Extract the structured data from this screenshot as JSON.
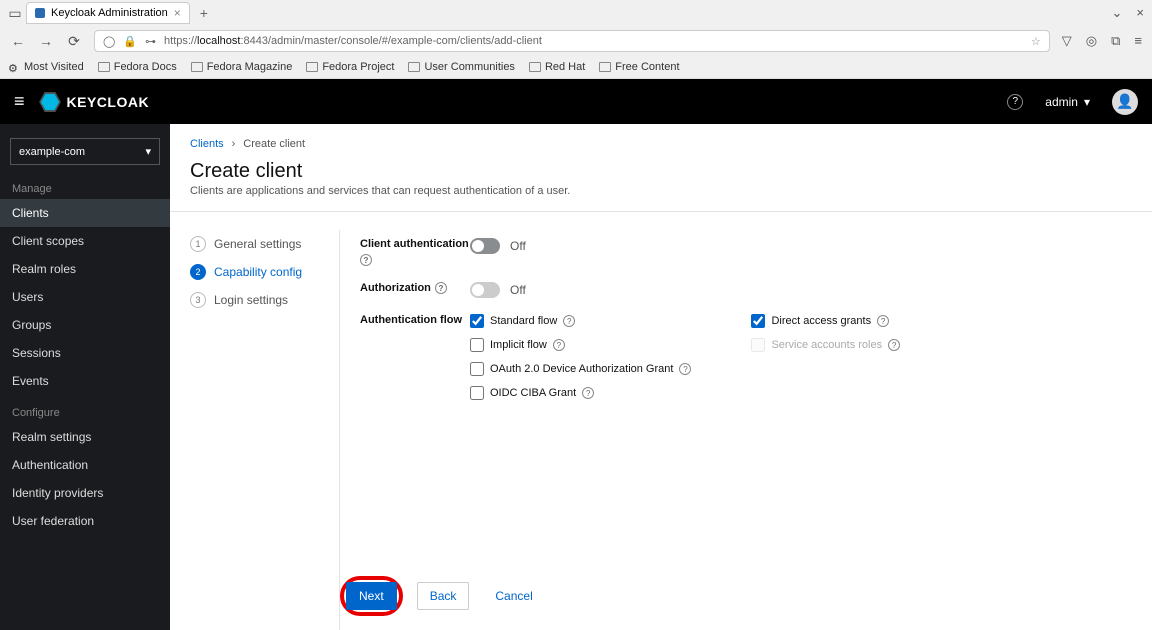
{
  "browser": {
    "tab_title": "Keycloak Administration",
    "url_prefix": "https://",
    "url_host": "localhost",
    "url_rest": ":8443/admin/master/console/#/example-com/clients/add-client",
    "minimize_glyph": "⌄",
    "close_glyph": "×",
    "bookmarks": [
      {
        "label": "Most Visited",
        "icon": "gear"
      },
      {
        "label": "Fedora Docs",
        "icon": "folder"
      },
      {
        "label": "Fedora Magazine",
        "icon": "folder"
      },
      {
        "label": "Fedora Project",
        "icon": "folder"
      },
      {
        "label": "User Communities",
        "icon": "folder"
      },
      {
        "label": "Red Hat",
        "icon": "folder"
      },
      {
        "label": "Free Content",
        "icon": "folder"
      }
    ]
  },
  "header": {
    "product": "KEYCLOAK",
    "help_glyph": "?",
    "user": "admin"
  },
  "sidebar": {
    "realm": "example-com",
    "sections": [
      {
        "title": "Manage",
        "items": [
          "Clients",
          "Client scopes",
          "Realm roles",
          "Users",
          "Groups",
          "Sessions",
          "Events"
        ],
        "active": "Clients"
      },
      {
        "title": "Configure",
        "items": [
          "Realm settings",
          "Authentication",
          "Identity providers",
          "User federation"
        ],
        "active": null
      }
    ]
  },
  "page": {
    "breadcrumb_root": "Clients",
    "breadcrumb_current": "Create client",
    "title": "Create client",
    "subtitle": "Clients are applications and services that can request authentication of a user."
  },
  "steps": [
    {
      "n": "1",
      "label": "General settings",
      "active": false
    },
    {
      "n": "2",
      "label": "Capability config",
      "active": true
    },
    {
      "n": "3",
      "label": "Login settings",
      "active": false
    }
  ],
  "form": {
    "client_auth_label": "Client authentication",
    "client_auth_state": "Off",
    "authorization_label": "Authorization",
    "authorization_state": "Off",
    "auth_flow_label": "Authentication flow",
    "flows": {
      "standard": {
        "label": "Standard flow",
        "checked": true,
        "disabled": false
      },
      "direct": {
        "label": "Direct access grants",
        "checked": true,
        "disabled": false
      },
      "implicit": {
        "label": "Implicit flow",
        "checked": false,
        "disabled": false
      },
      "service": {
        "label": "Service accounts roles",
        "checked": false,
        "disabled": true
      },
      "device": {
        "label": "OAuth 2.0 Device Authorization Grant",
        "checked": false,
        "disabled": false
      },
      "ciba": {
        "label": "OIDC CIBA Grant",
        "checked": false,
        "disabled": false
      }
    }
  },
  "footer": {
    "next": "Next",
    "back": "Back",
    "cancel": "Cancel"
  }
}
